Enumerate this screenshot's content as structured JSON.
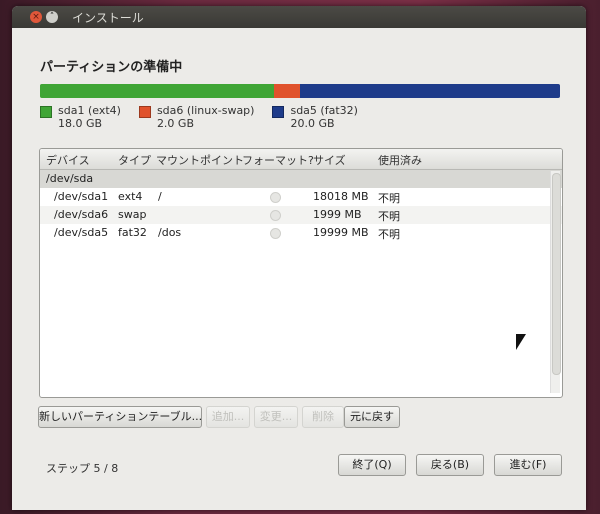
{
  "window": {
    "title": "インストール"
  },
  "page": {
    "title": "パーティションの準備中",
    "step": "ステップ 5 / 8"
  },
  "colors": {
    "green": "#3fa535",
    "orange": "#e0522c",
    "blue": "#1e3b8a"
  },
  "partitions_bar": [
    {
      "name": "sda1",
      "color": "#3fa535",
      "size_gb": 18.0
    },
    {
      "name": "sda6",
      "color": "#e0522c",
      "size_gb": 2.0
    },
    {
      "name": "sda5",
      "color": "#1e3b8a",
      "size_gb": 20.0
    }
  ],
  "legend": [
    {
      "label": "sda1 (ext4)",
      "size": "18.0 GB",
      "color": "#3fa535"
    },
    {
      "label": "sda6 (linux-swap)",
      "size": "2.0 GB",
      "color": "#e0522c"
    },
    {
      "label": "sda5 (fat32)",
      "size": "20.0 GB",
      "color": "#1e3b8a"
    }
  ],
  "table": {
    "headers": [
      "デバイス",
      "タイプ",
      "マウントポイント",
      "フォーマット?",
      "サイズ",
      "使用済み"
    ],
    "group": "/dev/sda",
    "rows": [
      {
        "device": "/dev/sda1",
        "type": "ext4",
        "mount": "/",
        "size": "18018 MB",
        "used": "不明"
      },
      {
        "device": "/dev/sda6",
        "type": "swap",
        "mount": "",
        "size": "1999 MB",
        "used": "不明"
      },
      {
        "device": "/dev/sda5",
        "type": "fat32",
        "mount": "/dos",
        "size": "19999 MB",
        "used": "不明"
      }
    ]
  },
  "buttons": {
    "new_table": "新しいパーティションテーブル...",
    "add": "追加...",
    "change": "変更...",
    "delete": "削除",
    "revert": "元に戻す",
    "quit": "終了(Q)",
    "back": "戻る(B)",
    "forward": "進む(F)"
  }
}
